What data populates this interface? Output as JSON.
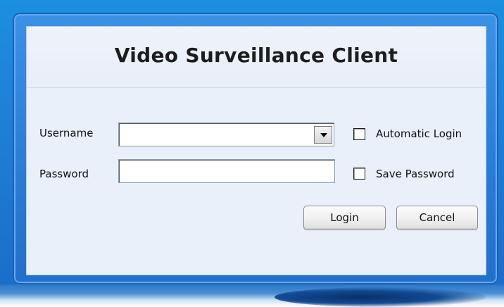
{
  "dialog": {
    "title": "Video Surveillance Client"
  },
  "form": {
    "username_label": "Username",
    "username_value": "",
    "password_label": "Password",
    "password_value": "",
    "automatic_login_label": "Automatic Login",
    "automatic_login_checked": false,
    "save_password_label": "Save Password",
    "save_password_checked": false
  },
  "buttons": {
    "login_label": "Login",
    "cancel_label": "Cancel"
  },
  "icons": {
    "combo_dropdown": "chevron-down-icon"
  },
  "colors": {
    "frame_blue": "#2b7fd9",
    "panel_background": "#eaf0fa"
  }
}
